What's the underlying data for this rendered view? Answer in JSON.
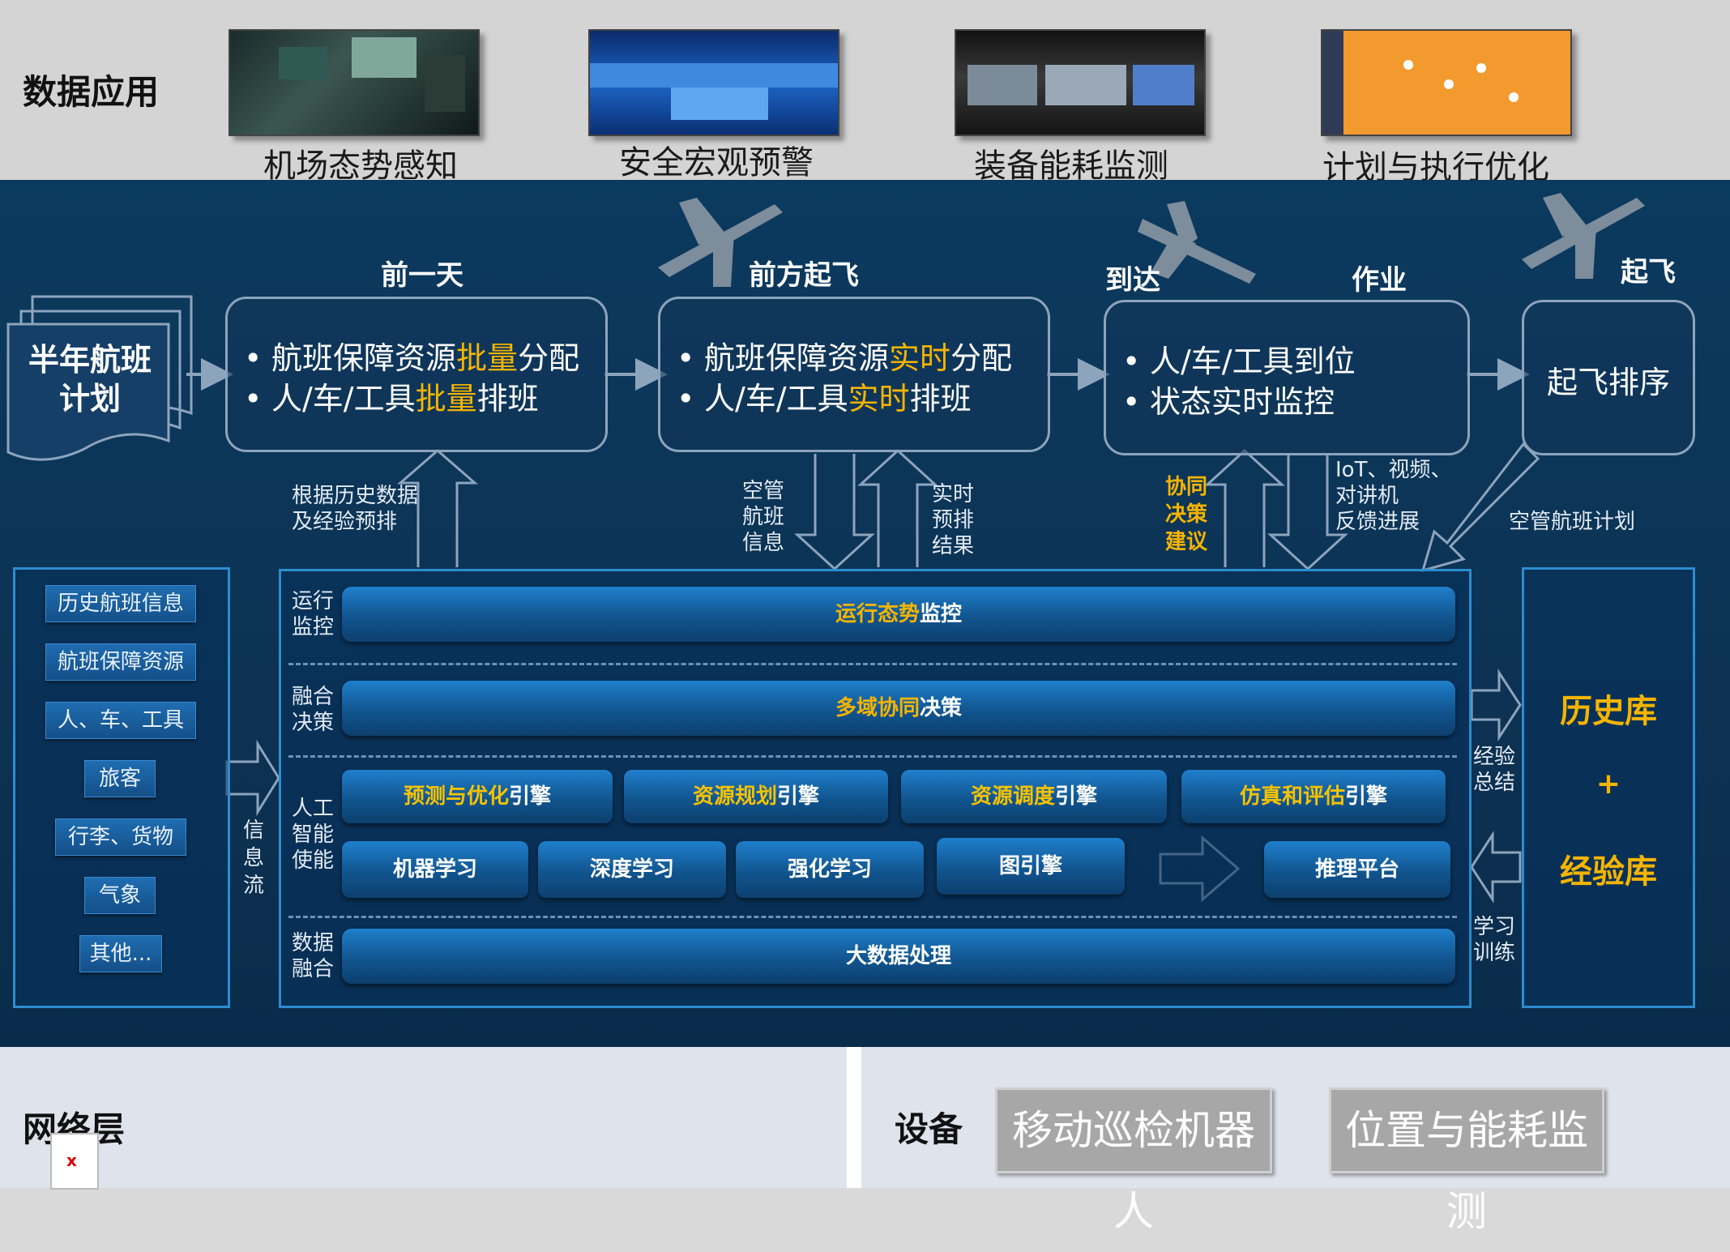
{
  "data_application": {
    "title": "数据应用",
    "apps": [
      {
        "label": "机场态势感知",
        "icon": "control-room-photo"
      },
      {
        "label": "安全宏观预警",
        "icon": "monitor-wall-photo"
      },
      {
        "label": "装备能耗监测",
        "icon": "video-wall-photo"
      },
      {
        "label": "计划与执行优化",
        "icon": "orange-map-screenshot"
      }
    ]
  },
  "flow": {
    "half_year_plan": {
      "line1": "半年航班",
      "line2": "计划"
    },
    "stage_titles": {
      "day_before": "前一天",
      "front_takeoff": "前方起飞",
      "arrival": "到达",
      "operation": "作业",
      "takeoff": "起飞"
    },
    "stage1": {
      "bullet": "•",
      "l1_pre": "航班保障资源",
      "l1_hl": "批量",
      "l1_post": "分配",
      "l2_pre": "人/车/工具",
      "l2_hl": "批量",
      "l2_post": "排班"
    },
    "stage2": {
      "bullet": "•",
      "l1_pre": "航班保障资源",
      "l1_hl": "实时",
      "l1_post": "分配",
      "l2_pre": "人/车/工具",
      "l2_hl": "实时",
      "l2_post": "排班"
    },
    "stage3": {
      "bullet": "•",
      "l1": "人/车/工具到位",
      "l2": "状态实时监控"
    },
    "stage4": {
      "label": "起飞排序"
    },
    "annotations": {
      "history_l1": "根据历史数据",
      "history_l2": "及经验预排",
      "atc_l1": "空管",
      "atc_l2": "航班",
      "atc_l3": "信息",
      "pre_l1": "实时",
      "pre_l2": "预排",
      "pre_l3": "结果",
      "coop_l1": "协同",
      "coop_l2": "决策",
      "coop_l3": "建议",
      "iot_l1": "IoT、视频、",
      "iot_l2": "对讲机",
      "iot_l3": "反馈进展",
      "atc_plan": "空管航班计划"
    }
  },
  "sources": {
    "items": [
      "历史航班信息",
      "航班保障资源",
      "人、车、工具",
      "旅客",
      "行李、货物",
      "气象",
      "其他..."
    ],
    "info_flow": [
      "信",
      "息",
      "流"
    ]
  },
  "platform": {
    "rows": {
      "ops": {
        "l1": "运行",
        "l2": "监控",
        "bar_hl": "运行态势",
        "bar_post": "监控"
      },
      "fusion": {
        "l1": "融合",
        "l2": "决策",
        "bar_hl": "多域协同",
        "bar_post": "决策"
      },
      "ai": {
        "l1": "人工",
        "l2": "智能",
        "l3": "使能"
      },
      "data": {
        "l1": "数据",
        "l2": "融合",
        "bar": "大数据处理"
      }
    },
    "engines": [
      {
        "hl": "预测与优化",
        "post": "引擎"
      },
      {
        "hl": "资源规划",
        "post": "引擎"
      },
      {
        "hl": "资源调度",
        "post": "引擎"
      },
      {
        "hl": "仿真和评估",
        "post": "引擎"
      }
    ],
    "ml": [
      "机器学习",
      "深度学习",
      "强化学习",
      "图引擎"
    ],
    "inference": "推理平台"
  },
  "knowledge": {
    "history": "历史库",
    "plus": "+",
    "experience": "经验库",
    "summary_l1": "经验",
    "summary_l2": "总结",
    "train_l1": "学习",
    "train_l2": "训练"
  },
  "bottom": {
    "network": "网络层",
    "device": "设备",
    "device_items": [
      "移动巡检机器人",
      "位置与能耗监测"
    ],
    "broken_image": "x"
  },
  "colors": {
    "highlight": "#f5b400",
    "panel_border": "#2d8ccf",
    "background_main": "#0d3253"
  }
}
